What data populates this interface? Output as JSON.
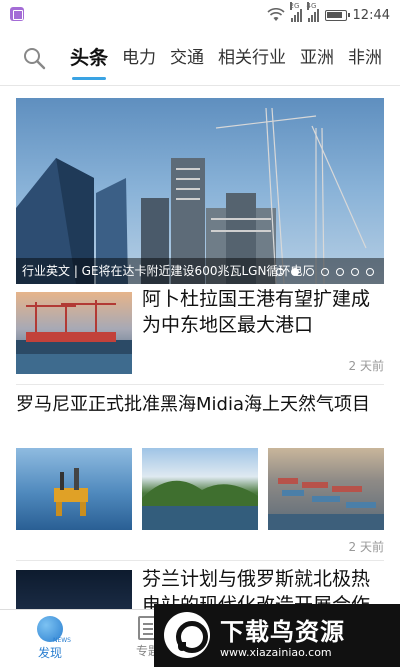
{
  "status_bar": {
    "network_1": "2G",
    "network_2": "4G",
    "time": "12:44"
  },
  "categories": {
    "tabs": [
      "头条",
      "电力",
      "交通",
      "相关行业",
      "亚洲",
      "非洲"
    ],
    "active_index": 0
  },
  "banner": {
    "caption": "行业英文 | GE将在达卡附近建设600兆瓦LGN循环电厂",
    "slide_count": 7,
    "active_slide": 1
  },
  "news": [
    {
      "title": "阿卜杜拉国王港有望扩建成为中东地区最大港口",
      "time": "2 天前"
    },
    {
      "title": "罗马尼亚正式批准黑海Midia海上天然气项目",
      "time": "2 天前"
    },
    {
      "title": "芬兰计划与俄罗斯就北极热电站的现代化改造开展合作"
    }
  ],
  "bottom_nav": {
    "discover_label": "发现",
    "discover_badge": "NEWS",
    "topic_label": "专题"
  },
  "watermark": {
    "title": "下载鸟资源",
    "url": "www.xiazainiao.com"
  },
  "colors": {
    "accent": "#3aa3e3",
    "nav_active": "#2b7fd0"
  }
}
